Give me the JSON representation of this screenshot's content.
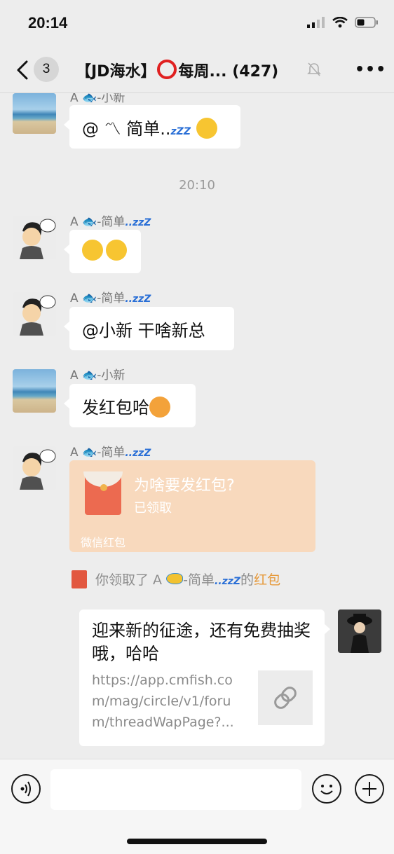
{
  "status_bar": {
    "time": "20:14"
  },
  "header": {
    "back_badge": "3",
    "title_prefix": "【JD海水】",
    "title_suffix": "每周...",
    "member_count": "(427)",
    "more_label": "•••"
  },
  "messages": [
    {
      "sender": "A 🐟-小新",
      "text": "@ 〽 简单..",
      "zz": "zZZ"
    },
    {
      "timestamp": "20:10"
    },
    {
      "sender": "A 🐟-简单",
      "sender_zz": "..zzZ",
      "text": ""
    },
    {
      "sender": "A 🐟-简单",
      "sender_zz": "..zzZ",
      "text": "@小新 干啥新总"
    },
    {
      "sender": "A 🐟-小新",
      "text": "发红包哈"
    },
    {
      "sender": "A 🐟-简单",
      "sender_zz": "..zzZ",
      "red_packet": {
        "title": "为啥要发红包?",
        "status": "已领取",
        "footer": "微信红包"
      }
    }
  ],
  "system_note": {
    "prefix": "你领取了 A",
    "name": "-简单",
    "zz": "..zzZ",
    "mid": "的",
    "link": "红包"
  },
  "link_card": {
    "title": "迎来新的征途，还有免费抽奖哦，哈哈",
    "url": "https://app.cmfish.com/mag/circle/v1/forum/threadWapPage?..."
  },
  "colors": {
    "background": "#ededed",
    "bubble": "#ffffff",
    "red_packet": "#f8d9bd",
    "accent_orange": "#e6993a"
  }
}
